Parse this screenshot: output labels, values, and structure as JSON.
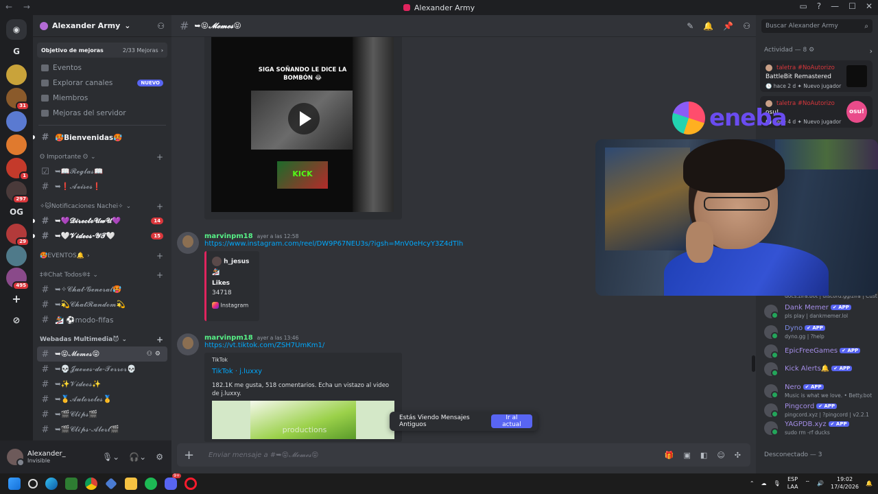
{
  "window": {
    "title": "Alexander Army",
    "nav": "← →"
  },
  "titlebar_icons": [
    "inbox-icon",
    "help-icon",
    "minimize-icon",
    "maximize-icon",
    "close-icon"
  ],
  "rail": {
    "servers": [
      {
        "name": "discord-home",
        "label": "",
        "color": "#313338"
      },
      {
        "name": "server-g",
        "label": "G",
        "color": "#313338"
      },
      {
        "name": "server-2",
        "label": "",
        "color": "#c9a33a"
      },
      {
        "name": "server-3",
        "label": "",
        "color": "#8a5a2b",
        "badge": "31"
      },
      {
        "name": "server-4",
        "label": "",
        "color": "#5a7ad1"
      },
      {
        "name": "server-5",
        "label": "",
        "color": "#e07a2e"
      },
      {
        "name": "server-6",
        "label": "",
        "color": "#c43a2b",
        "badge": "1"
      },
      {
        "name": "server-7",
        "label": "",
        "color": "#4a3a3a",
        "badge": "297"
      },
      {
        "name": "server-og",
        "label": "OG",
        "color": "#313338"
      },
      {
        "name": "server-8",
        "label": "",
        "color": "#b33a3a",
        "badge": "29"
      },
      {
        "name": "server-9",
        "label": "",
        "color": "#4f7a8a"
      },
      {
        "name": "server-10",
        "label": "",
        "color": "#8a4a8a",
        "badge": "495"
      }
    ]
  },
  "sidebar": {
    "server_name": "Alexander Army",
    "boost": {
      "label": "Objetivo de mejoras",
      "count": "2/33 Mejoras"
    },
    "menu": [
      {
        "label": "Eventos"
      },
      {
        "label": "Explorar canales",
        "badge": "NUEVO"
      },
      {
        "label": "Miembros"
      },
      {
        "label": "Mejoras del servidor"
      }
    ],
    "welcome": "🥵Bienvenidas🥵",
    "cat_importante": "ʘ Importante ʘ",
    "reglas": "➥📖𝓡𝓮𝓰𝓵𝓪𝓼📖",
    "avisos": "➥❗𝓐𝓿𝓲𝓼𝓸𝓼❗",
    "cat_notif": "✧🐱Notificaciones Nachei✧",
    "directo": "➥💜𝓓𝓲𝓻𝓮𝓬𝓽𝓸𝓤𝔀𝓤💜",
    "directo_badge": "14",
    "videos_yt": "➥🤍𝓥𝓲𝓭𝓮𝓸𝓼-𝓨𝓣🤍",
    "videos_yt_badge": "15",
    "cat_eventos": "🥵EVENTOS🔔",
    "cat_chat": "‡❊Chat Todos❊‡",
    "chat_general": "➥✧𝓒𝓱𝓪𝓽-𝓖𝓮𝓷𝓮𝓻𝓪𝓵🥵",
    "chat_random": "➥💫𝓒𝓱𝓪𝓽𝓡𝓪𝓷𝓭𝓸𝓶💫",
    "modo_fifas": "🏂 ⚽modo-fifas",
    "cat_webadas": "Webadas Multimedia😈",
    "memes": "➥😝𝓜𝓮𝓶𝓮𝓼😝",
    "jueves": "➥💀𝓙𝓾𝓮𝓿𝓮𝓼-𝓭𝓮-𝓣𝓮𝓻𝓻𝓸𝓻💀",
    "videos": "➥✨𝓥𝓲𝓭𝓮𝓸𝓼✨",
    "autoroles": "➥🥇𝓐𝓾𝓽𝓸𝓻𝓸𝓵𝓮𝓼🥇",
    "clips": "➥🎬𝓒𝓵𝓲𝓹𝓼🎬",
    "clips_alert": "➥🎬𝓒𝓵𝓲𝓹𝓼-𝓐𝓵𝓮𝓻𝓽🎬"
  },
  "user": {
    "name": "Alexander_",
    "status": "Invisible"
  },
  "chat": {
    "channel": "➥😝𝓜𝓮𝓶𝓮𝓼😝",
    "video_caption": "SIGA SOÑANDO LE DICE LA BOMBÓN 😂",
    "video_badge": "KICK",
    "messages": [
      {
        "author": "marvinpm18",
        "time": "ayer a las 12:58",
        "link": "https://www.instagram.com/reel/DW9P67NEU3s/?igsh=MnV0eHcyY3Z4dTlh",
        "embed_user": "h_jesus",
        "embed_label": "Likes",
        "embed_value": "34718",
        "embed_provider": "Instagram"
      },
      {
        "author": "marvinpm18",
        "time": "ayer a las 13:46",
        "link": "https://vt.tiktok.com/ZSH7UmKm1/",
        "embed_provider": "TikTok",
        "embed_title": "TikTok · j.luxxy",
        "embed_desc": "182.1K me gusta, 518 comentarios. Echa un vistazo al video de j.luxxy.",
        "embed_thumb_text": "productions"
      }
    ],
    "old_banner": "Estás Viendo Mensajes Antiguos",
    "old_banner_button": "Ir al actual",
    "composer_placeholder": "Enviar mensaje a #➥😝𝓜𝓮𝓶𝓮𝓼😝"
  },
  "members": {
    "search_placeholder": "Buscar Alexander Army",
    "activity_title": "Actividad — 8",
    "activities": [
      {
        "name": "taletra #NoAutorizo",
        "game": "BattleBit Remastered",
        "when": "hace 2 d",
        "tag": "Nuevo jugador"
      },
      {
        "name": "taletra #NoAutorizo",
        "game": "osu!",
        "when": "hace 4 d",
        "tag": "Nuevo jugador",
        "thumb_text": "osu!"
      }
    ],
    "partial_sub": "docs.zira.bot | discord.gg/zira | Cust",
    "bots": [
      {
        "name": "Dank Memer",
        "sub": "pls play | dankmemer.lol",
        "color": "#a58ee8",
        "tag": "✔ APP"
      },
      {
        "name": "Dyno",
        "sub": "dyno.gg | ?help",
        "color": "#7f8ce8",
        "tag": "✔ APP"
      },
      {
        "name": "EpicFreeGames",
        "sub": "",
        "color": "#a58ee8",
        "tag": "✔ APP"
      },
      {
        "name": "Kick Alerts",
        "sub": "",
        "color": "#a58ee8",
        "tag": "✔ APP",
        "emoji": "🔔"
      },
      {
        "name": "Nero",
        "sub": "Music is what we love. • Betty.bot",
        "color": "#a58ee8",
        "tag": "✔ APP"
      },
      {
        "name": "Pingcord",
        "sub": "pingcord.xyz | ?pingcord | v2.2.1",
        "color": "#a58ee8",
        "tag": "✔ APP"
      },
      {
        "name": "YAGPDB.xyz",
        "sub": "sudo rm -rf ducks",
        "color": "#a58ee8",
        "tag": "✔ APP"
      }
    ],
    "offline_title": "Desconectado — 3"
  },
  "overlay": {
    "logo_text": "eneba"
  },
  "taskbar": {
    "lang": "ESP",
    "lang2": "LAA",
    "time": "19:02",
    "date": "17/4/2026",
    "discord_badge": "9+"
  }
}
